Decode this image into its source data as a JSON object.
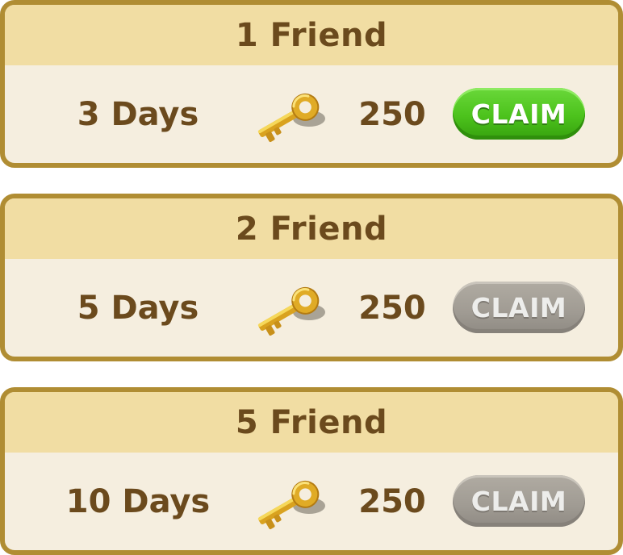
{
  "rewards": [
    {
      "title": "1 Friend",
      "duration": "3 Days",
      "amount": "250",
      "claim_label": "CLAIM",
      "claim_state": "active"
    },
    {
      "title": "2 Friend",
      "duration": "5 Days",
      "amount": "250",
      "claim_label": "CLAIM",
      "claim_state": "disabled"
    },
    {
      "title": "5 Friend",
      "duration": "10 Days",
      "amount": "250",
      "claim_label": "CLAIM",
      "claim_state": "disabled"
    }
  ],
  "reward_icon": "gold-key-icon",
  "colors": {
    "card_border": "#b08d33",
    "card_header": "#f1dda3",
    "card_body": "#f5eedf",
    "text": "#6b4a1d",
    "claim_active": "#4cc21c",
    "claim_disabled": "#a09b93"
  }
}
